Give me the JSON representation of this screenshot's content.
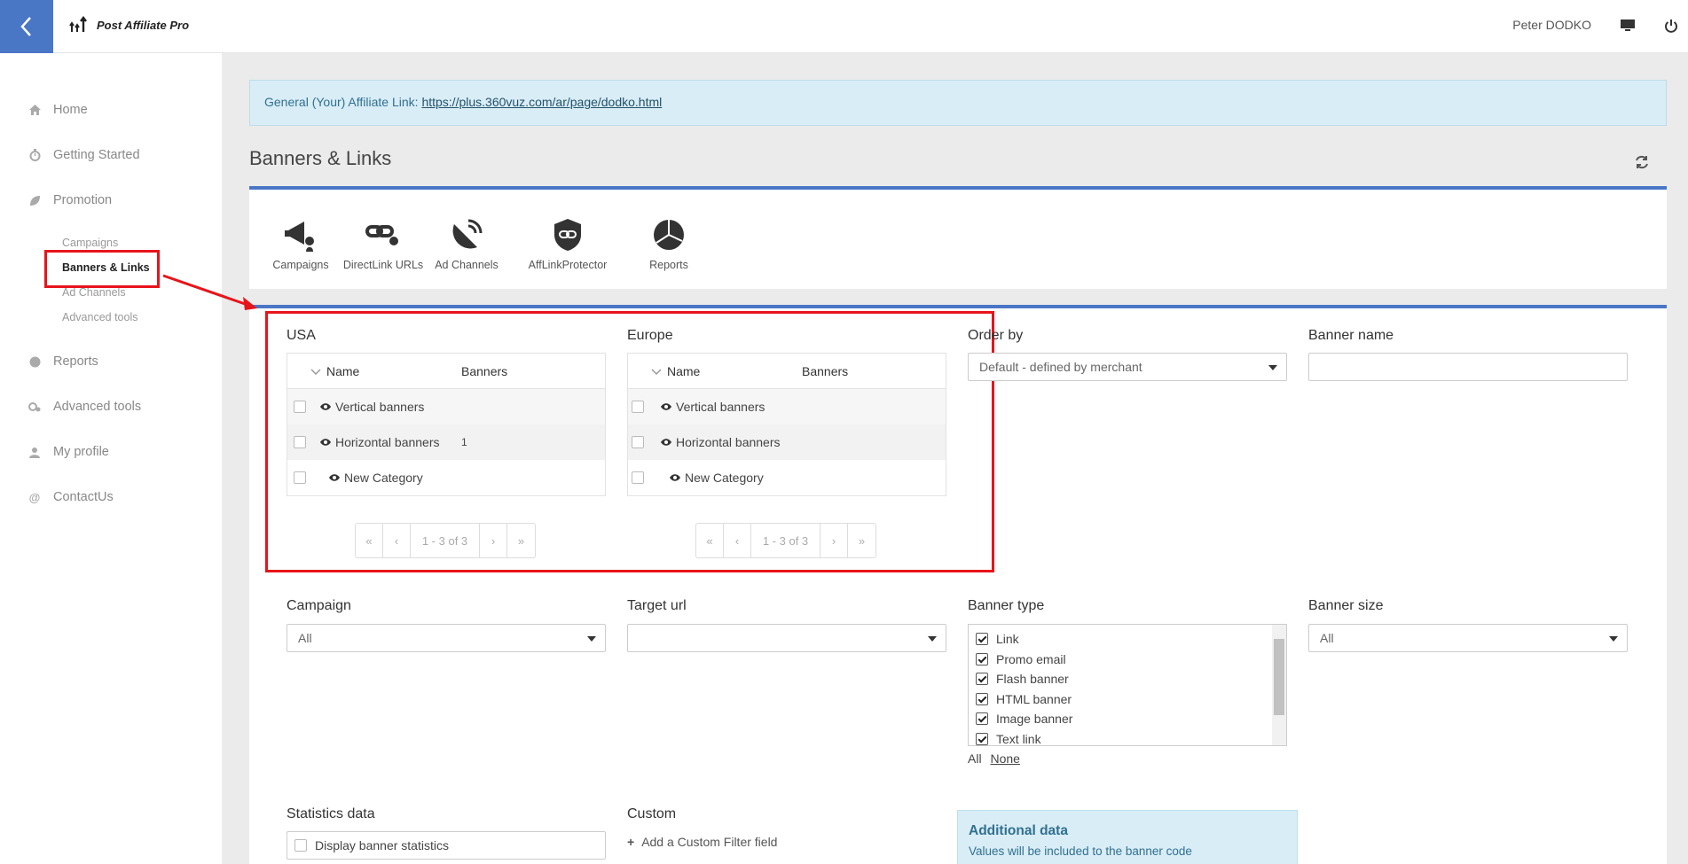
{
  "header": {
    "brand": "Post Affiliate Pro",
    "user": "Peter DODKO"
  },
  "sidebar": {
    "items": [
      {
        "label": "Home",
        "icon": "home-icon"
      },
      {
        "label": "Getting Started",
        "icon": "stopwatch-icon"
      },
      {
        "label": "Promotion",
        "icon": "leaf-icon"
      },
      {
        "label": "Reports",
        "icon": "globe-icon"
      },
      {
        "label": "Advanced tools",
        "icon": "gears-icon"
      },
      {
        "label": "My profile",
        "icon": "user-icon"
      },
      {
        "label": "ContactUs",
        "icon": "at-icon"
      }
    ],
    "sub_items": [
      "Campaigns",
      "Banners & Links",
      "Ad Channels",
      "Advanced tools"
    ]
  },
  "affiliate_link": {
    "label": "General (Your) Affiliate Link:",
    "url": "https://plus.360vuz.com/ar/page/dodko.html"
  },
  "page_title": "Banners & Links",
  "tabs": [
    "Campaigns",
    "DirectLink URLs",
    "Ad Channels",
    "AffLinkProtector",
    "Reports"
  ],
  "filters": {
    "usa": {
      "title": "USA",
      "col_name": "Name",
      "col_banners": "Banners",
      "rows": [
        {
          "name": "Vertical banners",
          "count": ""
        },
        {
          "name": "Horizontal banners",
          "count": "1"
        },
        {
          "name": "New Category",
          "count": ""
        }
      ],
      "pager": {
        "first": "«",
        "prev": "‹",
        "info": "1 - 3 of 3",
        "next": "›",
        "last": "»"
      }
    },
    "europe": {
      "title": "Europe",
      "col_name": "Name",
      "col_banners": "Banners",
      "rows": [
        {
          "name": "Vertical banners",
          "count": ""
        },
        {
          "name": "Horizontal banners",
          "count": ""
        },
        {
          "name": "New Category",
          "count": ""
        }
      ],
      "pager": {
        "first": "«",
        "prev": "‹",
        "info": "1 - 3 of 3",
        "next": "›",
        "last": "»"
      }
    },
    "order_by": {
      "label": "Order by",
      "value": "Default - defined by merchant"
    },
    "banner_name": {
      "label": "Banner name",
      "value": ""
    },
    "campaign": {
      "label": "Campaign",
      "value": "All"
    },
    "target_url": {
      "label": "Target url",
      "value": ""
    },
    "banner_type": {
      "label": "Banner type",
      "options": [
        "Link",
        "Promo email",
        "Flash banner",
        "HTML banner",
        "Image banner",
        "Text link"
      ],
      "all": "All",
      "none": "None"
    },
    "banner_size": {
      "label": "Banner size",
      "value": "All"
    },
    "statistics": {
      "label": "Statistics data",
      "checkbox": "Display banner statistics"
    },
    "custom": {
      "label": "Custom",
      "add": "Add a Custom Filter field"
    },
    "additional": {
      "title": "Additional data",
      "text": "Values will be included to the banner code"
    }
  },
  "colors": {
    "accent": "#4a76c6",
    "annotation": "#e8141b",
    "info_bg": "#d9edf7"
  }
}
